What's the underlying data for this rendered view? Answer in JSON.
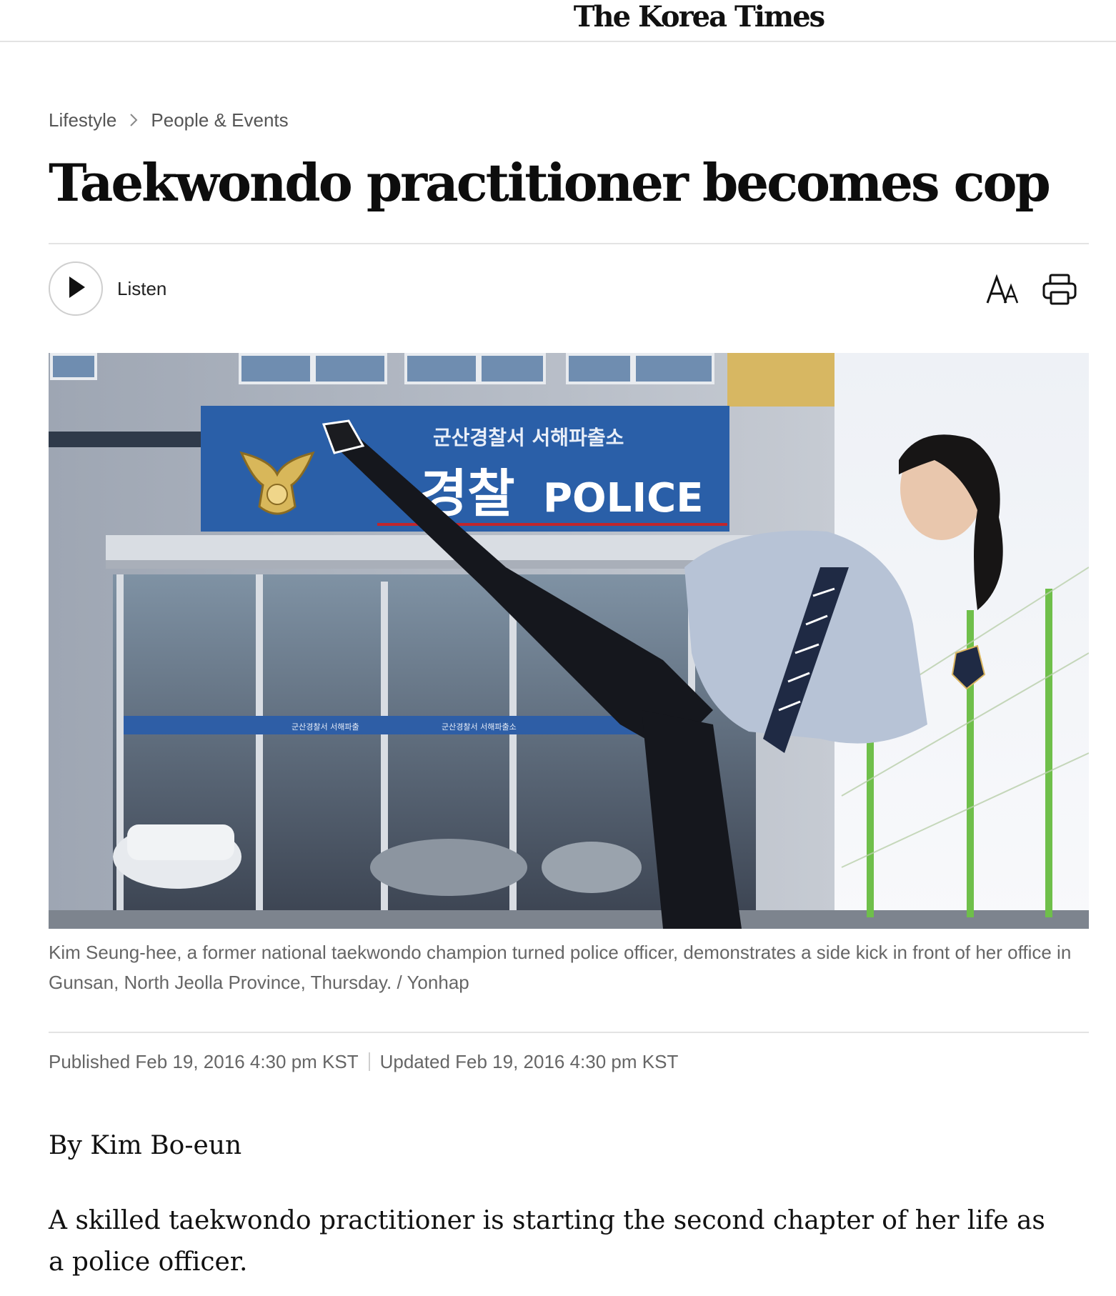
{
  "masthead": {
    "title": "The Korea Times"
  },
  "breadcrumb": {
    "section": "Lifestyle",
    "subsection": "People & Events"
  },
  "article": {
    "headline": "Taekwondo practitioner becomes cop",
    "byline": "By Kim Bo-eun",
    "lede": "A skilled taekwondo practitioner is starting the second chapter of her life as a police officer.",
    "published": "Published Feb 19, 2016 4:30 pm KST",
    "updated": "Updated Feb 19, 2016 4:30 pm KST"
  },
  "toolbar": {
    "listen_label": "Listen",
    "play_icon": "play-icon",
    "font_size_icon": "font-size-icon",
    "print_icon": "print-icon"
  },
  "photo": {
    "caption": "Kim Seung-hee, a former national taekwondo champion turned police officer, demonstrates a side kick in front of her office in Gunsan, North Jeolla Province, Thursday. / Yonhap",
    "sign_korean": "군산경찰서 서해파출소",
    "sign_korean_large": "경찰",
    "sign_english": "POLICE",
    "door_sign_left": "군산경찰서 서해파출",
    "door_sign_right": "군산경찰서 서해파출소"
  },
  "colors": {
    "text": "#111111",
    "muted": "#666666",
    "rule": "#e3e3e3",
    "sign_blue": "#2a5fa8"
  }
}
